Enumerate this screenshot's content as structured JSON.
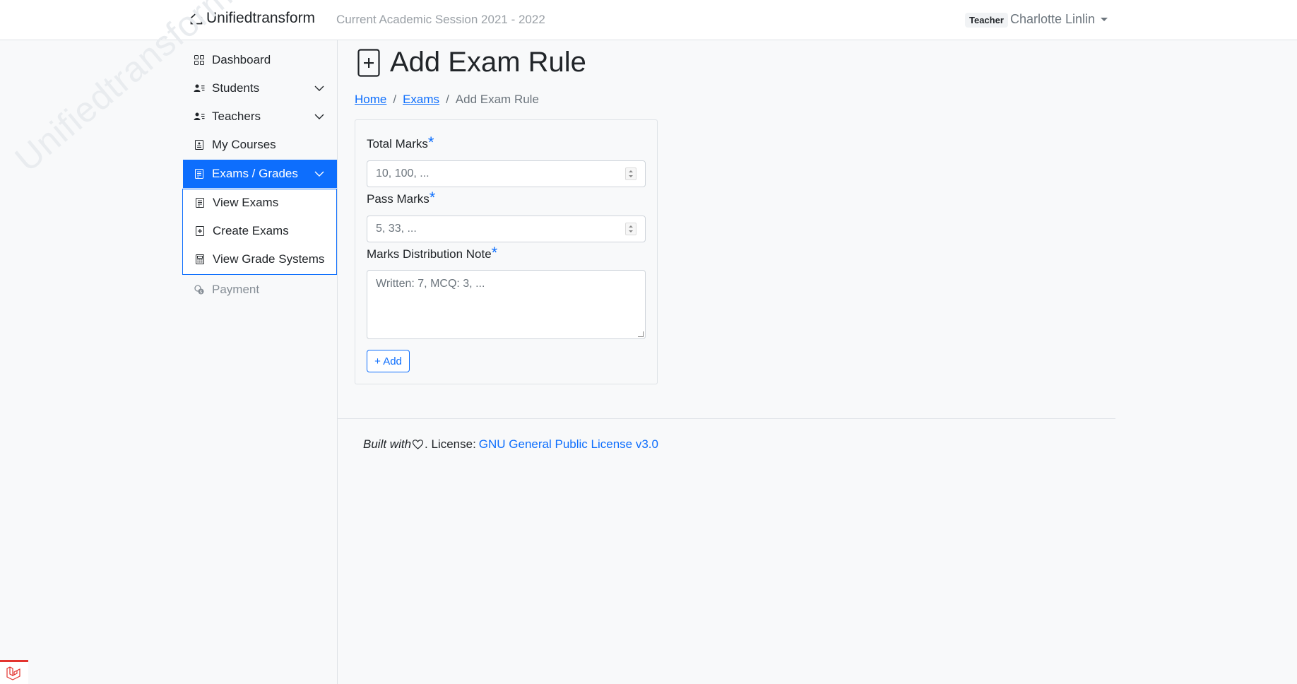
{
  "navbar": {
    "brand": "Unifiedtransform",
    "session": "Current Academic Session 2021 - 2022",
    "role": "Teacher",
    "user_name": "Charlotte Linlin"
  },
  "sidebar": {
    "watermark": "Unifiedtransform",
    "items": [
      {
        "label": "Dashboard",
        "icon": "grid-icon"
      },
      {
        "label": "Students",
        "icon": "person-lines-icon"
      },
      {
        "label": "Teachers",
        "icon": "person-lines-icon"
      },
      {
        "label": "My Courses",
        "icon": "journal-icon"
      },
      {
        "label": "Exams / Grades",
        "icon": "file-text-icon"
      },
      {
        "label": "Payment",
        "icon": "coins-icon"
      }
    ],
    "submenu": [
      {
        "label": "View Exams",
        "icon": "file-text-icon"
      },
      {
        "label": "Create Exams",
        "icon": "file-plus-icon"
      },
      {
        "label": "View Grade Systems",
        "icon": "calculator-icon"
      }
    ]
  },
  "page": {
    "title": "Add Exam Rule",
    "breadcrumb": [
      "Home",
      "Exams",
      "Add Exam Rule"
    ]
  },
  "form": {
    "total_marks": {
      "label": "Total Marks",
      "required": "*",
      "placeholder": "10, 100, ..."
    },
    "pass_marks": {
      "label": "Pass Marks",
      "required": "*",
      "placeholder": "5, 33, ..."
    },
    "note": {
      "label": "Marks Distribution Note",
      "required": "*",
      "placeholder": "Written: 7, MCQ: 3, ..."
    },
    "add_label": "+ Add"
  },
  "footer": {
    "built_with": "Built with",
    "license_prefix": ". License:",
    "license_link": "GNU General Public License v3.0"
  },
  "colors": {
    "accent": "#0d6efd",
    "background": "#f8f9fa"
  }
}
